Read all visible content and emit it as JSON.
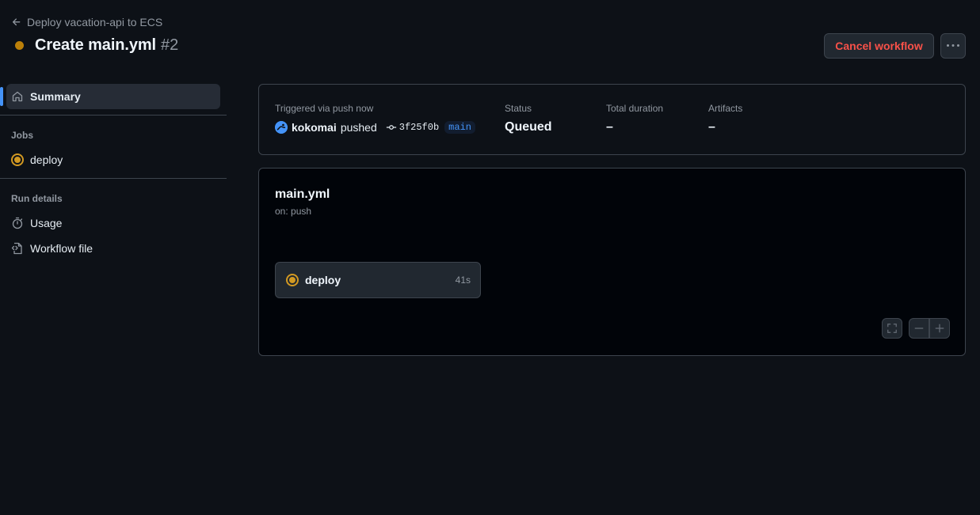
{
  "header": {
    "back_label": "Deploy vacation-api to ECS",
    "title": "Create main.yml",
    "run_number": "#2",
    "cancel_label": "Cancel workflow",
    "status_color": "#bb8009"
  },
  "sidebar": {
    "summary_label": "Summary",
    "jobs_heading": "Jobs",
    "jobs": [
      {
        "label": "deploy",
        "status": "queued"
      }
    ],
    "run_details_heading": "Run details",
    "usage_label": "Usage",
    "workflow_file_label": "Workflow file"
  },
  "summary": {
    "trigger_label": "Triggered via push now",
    "actor": "kokomai",
    "action": "pushed",
    "commit": "3f25f0b",
    "branch": "main",
    "status_label": "Status",
    "status_value": "Queued",
    "duration_label": "Total duration",
    "duration_value": "–",
    "artifacts_label": "Artifacts",
    "artifacts_value": "–"
  },
  "graph": {
    "workflow_name": "main.yml",
    "trigger": "on: push",
    "job_name": "deploy",
    "job_time": "41s"
  },
  "colors": {
    "accent": "#4493f8",
    "danger": "#f85149",
    "pending": "#d29922"
  }
}
